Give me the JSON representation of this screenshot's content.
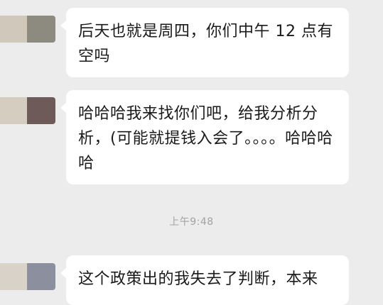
{
  "messages": [
    {
      "sender": "contact",
      "text": "后天也就是周四，你们中午 12 点有空吗"
    },
    {
      "sender": "contact",
      "text": "哈哈哈我来找你们吧，给我分析分析，(可能就提钱入会了。。。。哈哈哈哈"
    },
    {
      "sender": "contact",
      "text": "这个政策出的我失去了判断，本来"
    }
  ],
  "timestamp": "上午9:48",
  "colors": {
    "background": "#ececec",
    "bubble": "#ffffff",
    "text": "#1a1a1a",
    "timestamp": "#a3a3a3"
  }
}
